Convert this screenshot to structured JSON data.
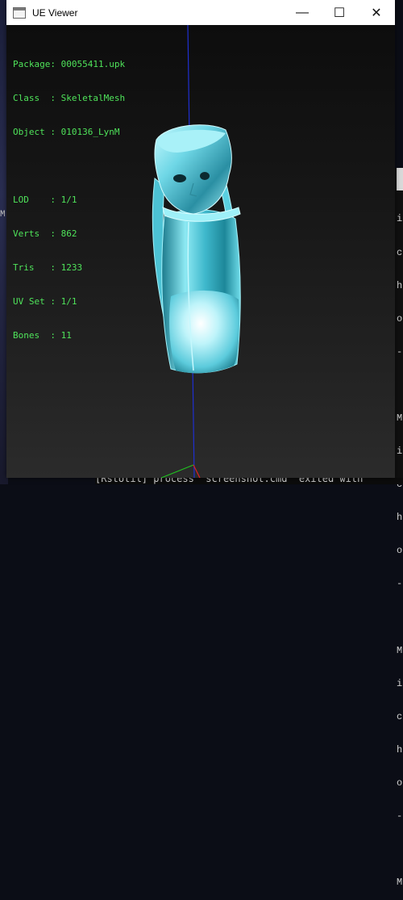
{
  "window": {
    "title": "UE Viewer",
    "minimize_glyph": "—",
    "maximize_glyph": "☐",
    "close_glyph": "✕"
  },
  "info": {
    "rows": [
      {
        "label": "Package",
        "sep": ": ",
        "value": "00055411.upk"
      },
      {
        "label": "Class  ",
        "sep": ": ",
        "value": "SkeletalMesh"
      },
      {
        "label": "Object ",
        "sep": ": ",
        "value": "010136_LynM"
      }
    ],
    "stats": [
      {
        "label": "LOD    ",
        "sep": ": ",
        "value": "1/1"
      },
      {
        "label": "Verts  ",
        "sep": ": ",
        "value": "862"
      },
      {
        "label": "Tris   ",
        "sep": ": ",
        "value": "1233"
      },
      {
        "label": "UV Set ",
        "sep": ": ",
        "value": "1/1"
      },
      {
        "label": "Bones  ",
        "sep": ": ",
        "value": "11"
      }
    ]
  },
  "background": {
    "left_letter": "M",
    "right_console_chars": [
      "i",
      "c",
      "h",
      "o",
      "-",
      "",
      "M",
      "i",
      "c",
      "h",
      "o",
      "-",
      "",
      "M",
      "i",
      "c",
      "h",
      "o",
      "-",
      "",
      "M"
    ],
    "bottom_console_text": "[RstUtil] process \"screenshot.cmd\" exited with"
  },
  "colors": {
    "info_text": "#4fe35a",
    "mesh": "#7fe8f2",
    "axis_z": "#1f2fd0",
    "axis_x": "#e02020",
    "axis_y": "#20c020"
  }
}
